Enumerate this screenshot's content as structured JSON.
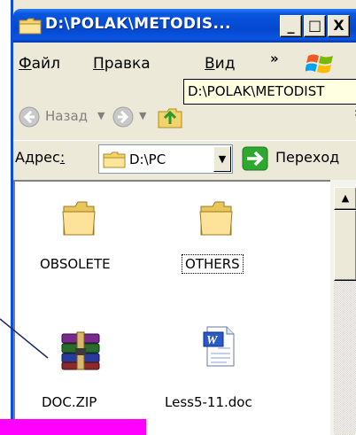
{
  "window": {
    "title": "D:\\POLAK\\METODIS...",
    "caption_buttons": {
      "minimize": "_",
      "maximize": "□",
      "close": "X"
    }
  },
  "menu": {
    "items": [
      {
        "label_u": "Ф",
        "label_rest": "айл"
      },
      {
        "label_u": "П",
        "label_rest": "равка"
      },
      {
        "label_u": "В",
        "label_rest": "ид"
      }
    ],
    "overflow": "»"
  },
  "tooltip": {
    "text": "D:\\POLAK\\METODIST"
  },
  "toolbar": {
    "back_label": "Назад",
    "overflow": "»"
  },
  "address": {
    "label_main": "Адрес",
    "label_u": ":",
    "value": "D:\\PC",
    "go_label": "Переход"
  },
  "files": [
    {
      "name": "OBSOLETE",
      "type": "folder-icon"
    },
    {
      "name": "OTHERS",
      "type": "folder-icon"
    },
    {
      "name": "DOC.ZIP",
      "type": "winrar-archive-icon"
    },
    {
      "name": "Less5-11.doc",
      "type": "word-document-icon"
    }
  ],
  "colors": {
    "titlebar": "#0548d0",
    "highlight_bar": "#ff00ff",
    "tooltip_bg": "#ffffe1"
  }
}
